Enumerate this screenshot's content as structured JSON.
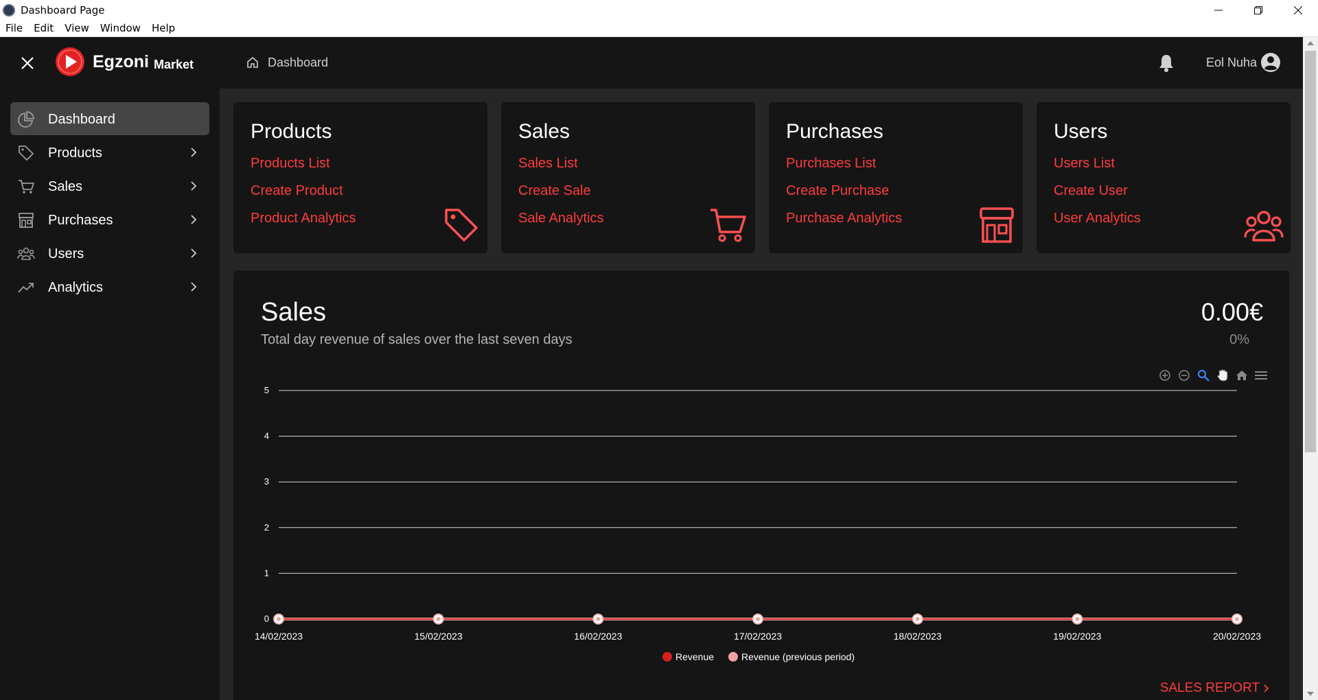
{
  "window": {
    "title": "Dashboard Page",
    "menu": [
      "File",
      "Edit",
      "View",
      "Window",
      "Help"
    ]
  },
  "header": {
    "brand": "Egzoni",
    "brand_sub": "Market",
    "breadcrumb": "Dashboard",
    "user_name": "Eol Nuha"
  },
  "sidebar": {
    "items": [
      {
        "label": "Dashboard",
        "icon": "pie-chart-icon",
        "active": true
      },
      {
        "label": "Products",
        "icon": "tag-icon"
      },
      {
        "label": "Sales",
        "icon": "cart-icon"
      },
      {
        "label": "Purchases",
        "icon": "store-icon"
      },
      {
        "label": "Users",
        "icon": "users-icon"
      },
      {
        "label": "Analytics",
        "icon": "trend-icon"
      }
    ]
  },
  "cards": [
    {
      "title": "Products",
      "links": [
        "Products List",
        "Create Product",
        "Product Analytics"
      ],
      "icon": "tag-icon"
    },
    {
      "title": "Sales",
      "links": [
        "Sales List",
        "Create Sale",
        "Sale Analytics"
      ],
      "icon": "cart-icon"
    },
    {
      "title": "Purchases",
      "links": [
        "Purchases List",
        "Create Purchase",
        "Purchase Analytics"
      ],
      "icon": "store-icon"
    },
    {
      "title": "Users",
      "links": [
        "Users List",
        "Create User",
        "User Analytics"
      ],
      "icon": "users-icon"
    }
  ],
  "sales_panel": {
    "title": "Sales",
    "subtitle": "Total day revenue of sales over the last seven days",
    "total": "0.00€",
    "percent": "0%",
    "report_link": "SALES REPORT",
    "toolbar": [
      "zoom-in-icon",
      "zoom-out-icon",
      "zoom-select-icon",
      "pan-hand-icon",
      "reset-home-icon",
      "menu-icon"
    ]
  },
  "colors": {
    "accent": "#ff3c3c",
    "revenue": "#d42020",
    "revenue_prev": "#f4a0a0"
  },
  "chart_data": {
    "type": "line",
    "categories": [
      "14/02/2023",
      "15/02/2023",
      "16/02/2023",
      "17/02/2023",
      "18/02/2023",
      "19/02/2023",
      "20/02/2023"
    ],
    "series": [
      {
        "name": "Revenue",
        "values": [
          0,
          0,
          0,
          0,
          0,
          0,
          0
        ]
      },
      {
        "name": "Revenue (previous period)",
        "values": [
          0,
          0,
          0,
          0,
          0,
          0,
          0
        ]
      }
    ],
    "yticks": [
      "0",
      "1",
      "2",
      "3",
      "4",
      "5"
    ],
    "ylim": [
      0,
      5
    ],
    "grid": true,
    "legend": "bottom-center"
  }
}
